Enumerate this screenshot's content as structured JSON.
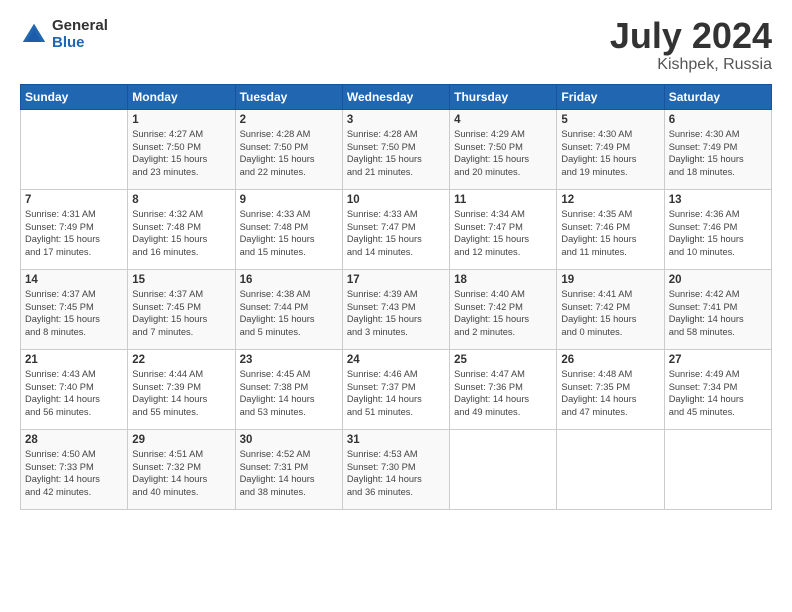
{
  "logo": {
    "general": "General",
    "blue": "Blue"
  },
  "title": {
    "month": "July 2024",
    "location": "Kishpek, Russia"
  },
  "headers": [
    "Sunday",
    "Monday",
    "Tuesday",
    "Wednesday",
    "Thursday",
    "Friday",
    "Saturday"
  ],
  "weeks": [
    [
      {
        "day": "",
        "info": ""
      },
      {
        "day": "1",
        "info": "Sunrise: 4:27 AM\nSunset: 7:50 PM\nDaylight: 15 hours\nand 23 minutes."
      },
      {
        "day": "2",
        "info": "Sunrise: 4:28 AM\nSunset: 7:50 PM\nDaylight: 15 hours\nand 22 minutes."
      },
      {
        "day": "3",
        "info": "Sunrise: 4:28 AM\nSunset: 7:50 PM\nDaylight: 15 hours\nand 21 minutes."
      },
      {
        "day": "4",
        "info": "Sunrise: 4:29 AM\nSunset: 7:50 PM\nDaylight: 15 hours\nand 20 minutes."
      },
      {
        "day": "5",
        "info": "Sunrise: 4:30 AM\nSunset: 7:49 PM\nDaylight: 15 hours\nand 19 minutes."
      },
      {
        "day": "6",
        "info": "Sunrise: 4:30 AM\nSunset: 7:49 PM\nDaylight: 15 hours\nand 18 minutes."
      }
    ],
    [
      {
        "day": "7",
        "info": "Sunrise: 4:31 AM\nSunset: 7:49 PM\nDaylight: 15 hours\nand 17 minutes."
      },
      {
        "day": "8",
        "info": "Sunrise: 4:32 AM\nSunset: 7:48 PM\nDaylight: 15 hours\nand 16 minutes."
      },
      {
        "day": "9",
        "info": "Sunrise: 4:33 AM\nSunset: 7:48 PM\nDaylight: 15 hours\nand 15 minutes."
      },
      {
        "day": "10",
        "info": "Sunrise: 4:33 AM\nSunset: 7:47 PM\nDaylight: 15 hours\nand 14 minutes."
      },
      {
        "day": "11",
        "info": "Sunrise: 4:34 AM\nSunset: 7:47 PM\nDaylight: 15 hours\nand 12 minutes."
      },
      {
        "day": "12",
        "info": "Sunrise: 4:35 AM\nSunset: 7:46 PM\nDaylight: 15 hours\nand 11 minutes."
      },
      {
        "day": "13",
        "info": "Sunrise: 4:36 AM\nSunset: 7:46 PM\nDaylight: 15 hours\nand 10 minutes."
      }
    ],
    [
      {
        "day": "14",
        "info": "Sunrise: 4:37 AM\nSunset: 7:45 PM\nDaylight: 15 hours\nand 8 minutes."
      },
      {
        "day": "15",
        "info": "Sunrise: 4:37 AM\nSunset: 7:45 PM\nDaylight: 15 hours\nand 7 minutes."
      },
      {
        "day": "16",
        "info": "Sunrise: 4:38 AM\nSunset: 7:44 PM\nDaylight: 15 hours\nand 5 minutes."
      },
      {
        "day": "17",
        "info": "Sunrise: 4:39 AM\nSunset: 7:43 PM\nDaylight: 15 hours\nand 3 minutes."
      },
      {
        "day": "18",
        "info": "Sunrise: 4:40 AM\nSunset: 7:42 PM\nDaylight: 15 hours\nand 2 minutes."
      },
      {
        "day": "19",
        "info": "Sunrise: 4:41 AM\nSunset: 7:42 PM\nDaylight: 15 hours\nand 0 minutes."
      },
      {
        "day": "20",
        "info": "Sunrise: 4:42 AM\nSunset: 7:41 PM\nDaylight: 14 hours\nand 58 minutes."
      }
    ],
    [
      {
        "day": "21",
        "info": "Sunrise: 4:43 AM\nSunset: 7:40 PM\nDaylight: 14 hours\nand 56 minutes."
      },
      {
        "day": "22",
        "info": "Sunrise: 4:44 AM\nSunset: 7:39 PM\nDaylight: 14 hours\nand 55 minutes."
      },
      {
        "day": "23",
        "info": "Sunrise: 4:45 AM\nSunset: 7:38 PM\nDaylight: 14 hours\nand 53 minutes."
      },
      {
        "day": "24",
        "info": "Sunrise: 4:46 AM\nSunset: 7:37 PM\nDaylight: 14 hours\nand 51 minutes."
      },
      {
        "day": "25",
        "info": "Sunrise: 4:47 AM\nSunset: 7:36 PM\nDaylight: 14 hours\nand 49 minutes."
      },
      {
        "day": "26",
        "info": "Sunrise: 4:48 AM\nSunset: 7:35 PM\nDaylight: 14 hours\nand 47 minutes."
      },
      {
        "day": "27",
        "info": "Sunrise: 4:49 AM\nSunset: 7:34 PM\nDaylight: 14 hours\nand 45 minutes."
      }
    ],
    [
      {
        "day": "28",
        "info": "Sunrise: 4:50 AM\nSunset: 7:33 PM\nDaylight: 14 hours\nand 42 minutes."
      },
      {
        "day": "29",
        "info": "Sunrise: 4:51 AM\nSunset: 7:32 PM\nDaylight: 14 hours\nand 40 minutes."
      },
      {
        "day": "30",
        "info": "Sunrise: 4:52 AM\nSunset: 7:31 PM\nDaylight: 14 hours\nand 38 minutes."
      },
      {
        "day": "31",
        "info": "Sunrise: 4:53 AM\nSunset: 7:30 PM\nDaylight: 14 hours\nand 36 minutes."
      },
      {
        "day": "",
        "info": ""
      },
      {
        "day": "",
        "info": ""
      },
      {
        "day": "",
        "info": ""
      }
    ]
  ]
}
